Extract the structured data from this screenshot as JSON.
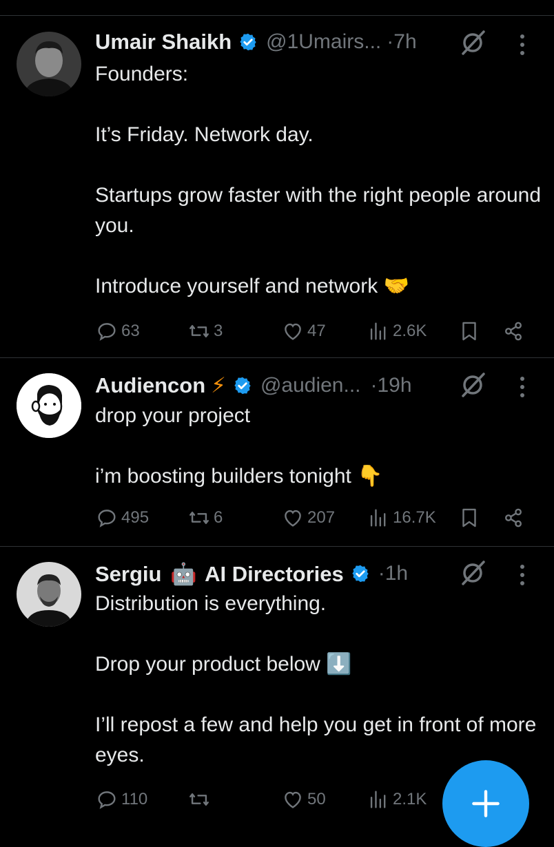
{
  "tweets": [
    {
      "name": "Umair Shaikh",
      "handle": "@1Umairs...",
      "time": "7h",
      "lines": [
        "Founders:",
        "",
        "It’s Friday. Network day.",
        "",
        "Startups grow faster with the right people around you.",
        "",
        "Introduce yourself and network 🤝"
      ],
      "replies": "63",
      "reposts": "3",
      "likes": "47",
      "views": "2.6K"
    },
    {
      "name": "Audiencon ⚡",
      "handle": "@audien...",
      "time": "19h",
      "lines": [
        "drop your project",
        "",
        "i’m boosting builders tonight 👇"
      ],
      "replies": "495",
      "reposts": "6",
      "likes": "207",
      "views": "16.7K"
    },
    {
      "name": "Sergiu 🤖 AI Directories",
      "handle": "",
      "time": "1h",
      "lines": [
        "Distribution is everything.",
        "",
        "Drop your product below ⬇️",
        "",
        "I’ll repost a few and help you get in front of more eyes."
      ],
      "replies": "110",
      "reposts": "",
      "likes": "50",
      "views": "2.1K"
    }
  ],
  "colors": {
    "accent": "#1d9bf0",
    "muted": "#71767b",
    "text": "#e7e9ea",
    "divider": "#2f3336"
  },
  "icons": [
    "verified-badge-icon",
    "grok-icon",
    "more-icon",
    "reply-icon",
    "repost-icon",
    "like-icon",
    "views-icon",
    "bookmark-icon",
    "share-icon",
    "compose-plus-icon"
  ]
}
